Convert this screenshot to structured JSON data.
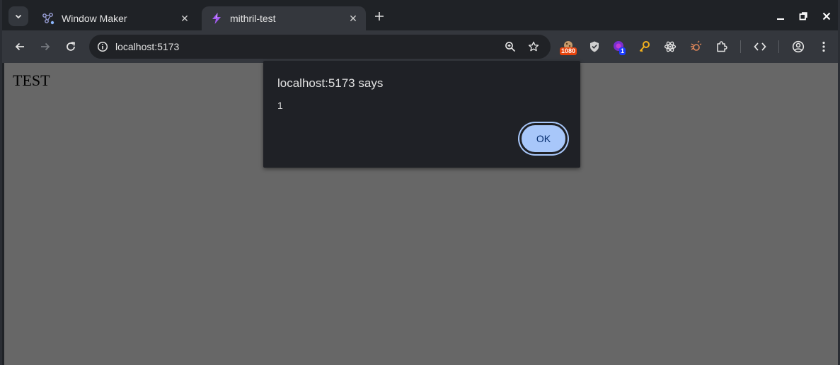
{
  "browser": {
    "tabs": [
      {
        "title": "Window Maker",
        "favicon": "react-flow-icon",
        "active": false
      },
      {
        "title": "mithril-test",
        "favicon": "vite-lightning-icon",
        "active": true
      }
    ],
    "close_glyph": "✕",
    "new_tab_glyph": "+",
    "address": "localhost:5173",
    "extensions": [
      {
        "name": "cookie-extension-icon",
        "badge": "1080",
        "badge_color": "#e8430b"
      },
      {
        "name": "shield-extension-icon",
        "badge": "",
        "badge_color": ""
      },
      {
        "name": "purple-extension-icon",
        "badge": "1",
        "badge_color": "#1a3cff"
      },
      {
        "name": "key-extension-icon",
        "badge": "",
        "badge_color": ""
      },
      {
        "name": "react-devtools-icon",
        "badge": "",
        "badge_color": ""
      },
      {
        "name": "bug-extension-icon",
        "badge": "",
        "badge_color": ""
      },
      {
        "name": "puzzle-extensions-icon",
        "badge": "",
        "badge_color": ""
      }
    ]
  },
  "page": {
    "heading": "TEST"
  },
  "dialog": {
    "title": "localhost:5173 says",
    "message": "1",
    "ok_label": "OK"
  },
  "colors": {
    "accent": "#a8c7fa",
    "page_background": "#676767",
    "dialog_background": "#1f2126"
  }
}
